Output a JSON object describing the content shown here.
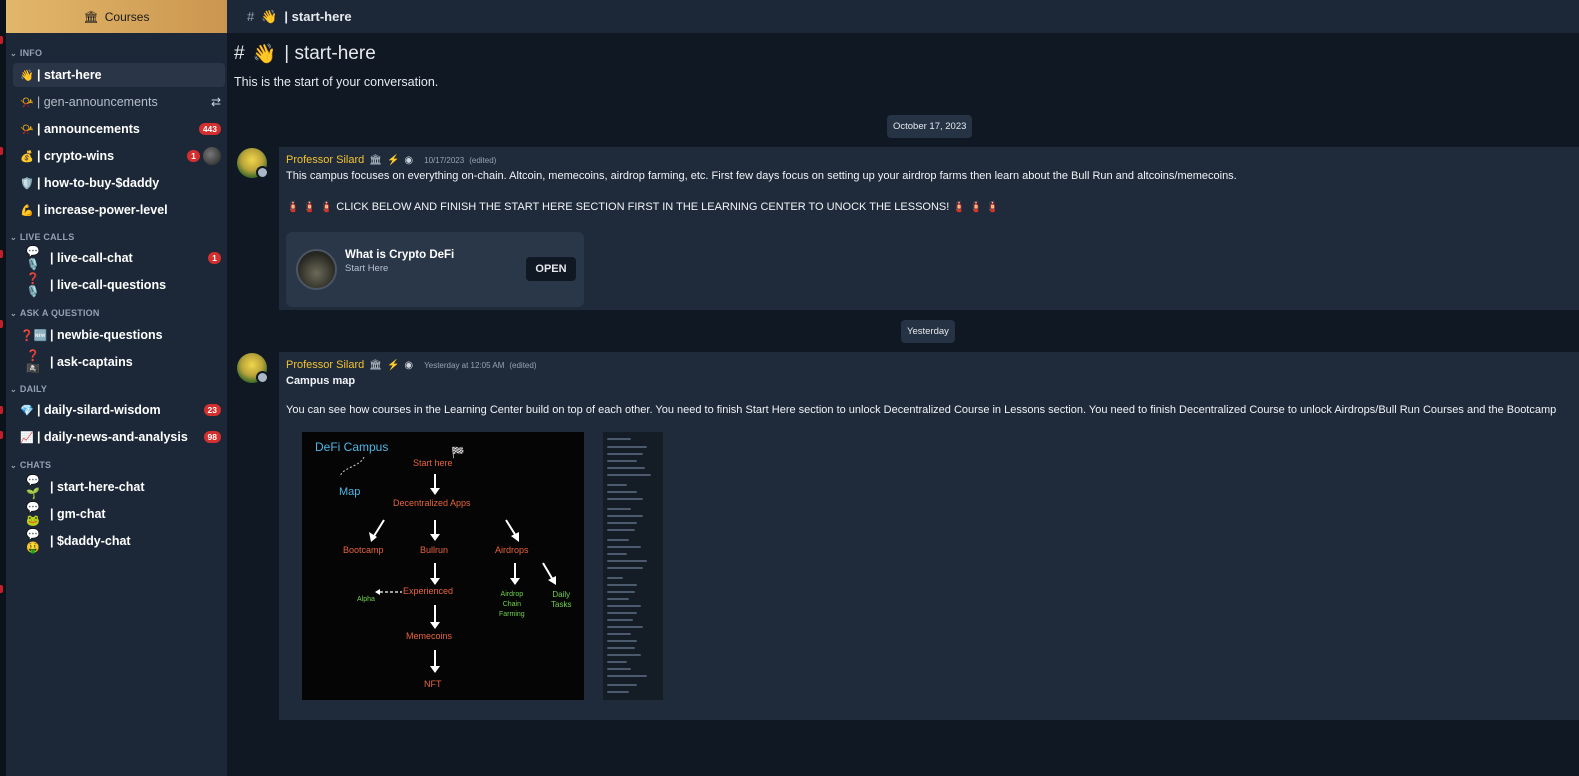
{
  "sidebar": {
    "courses_label": "Courses",
    "categories": {
      "info": "INFO",
      "live_calls": "LIVE CALLS",
      "ask_question": "ASK A QUESTION",
      "daily": "DAILY",
      "chats": "CHATS"
    },
    "channels": [
      {
        "emoji": "👋",
        "label": "| start-here"
      },
      {
        "emoji": "📯",
        "label": "| gen-announcements",
        "icon": "swap-icon"
      },
      {
        "emoji": "📯",
        "label": "| announcements",
        "badge": "443"
      },
      {
        "emoji": "💰",
        "label": "| crypto-wins",
        "badge": "1"
      },
      {
        "emoji": "🛡️",
        "label": "| how-to-buy-$daddy"
      },
      {
        "emoji": "💪",
        "label": "| increase-power-level"
      },
      {
        "emoji": "💬🎙️",
        "label": "| live-call-chat",
        "badge": "1"
      },
      {
        "emoji": "❓🎙️",
        "label": "| live-call-questions"
      },
      {
        "emoji": "❓🆕",
        "label": "| newbie-questions"
      },
      {
        "emoji": "❓🏴‍☠️",
        "label": "| ask-captains"
      },
      {
        "emoji": "💎",
        "label": "| daily-silard-wisdom",
        "badge": "23"
      },
      {
        "emoji": "📈",
        "label": "| daily-news-and-analysis",
        "badge": "98"
      },
      {
        "emoji": "💬🌱",
        "label": "| start-here-chat"
      },
      {
        "emoji": "💬🐸",
        "label": "| gm-chat"
      },
      {
        "emoji": "💬🤑",
        "label": "| $daddy-chat"
      }
    ]
  },
  "topbar": {
    "hash": "#",
    "emoji": "👋",
    "title": "| start-here"
  },
  "header": {
    "hash": "#",
    "emoji": "👋",
    "title": "| start-here",
    "subtitle": "This is the start of your conversation."
  },
  "dates": {
    "first": "October 17, 2023",
    "second": "Yesterday"
  },
  "messages": [
    {
      "author": "Professor Silard",
      "timestamp": "10/17/2023",
      "edited": "(edited)",
      "line1": "This campus focuses on everything on-chain. Altcoin, memecoins, airdrop farming, etc. First few days focus on setting up your airdrop farms then learn about the Bull Run and altcoins/memecoins.",
      "line2_prefix": "🧯 🧯 🧯",
      "line2": "CLICK BELOW AND FINISH THE START HERE SECTION FIRST IN THE LEARNING CENTER TO UNOCK THE LESSONS!",
      "line2_suffix": "🧯 🧯 🧯",
      "card": {
        "title": "What is Crypto DeFi",
        "subtitle": "Start Here",
        "button": "OPEN"
      }
    },
    {
      "author": "Professor Silard",
      "timestamp": "Yesterday at 12:05 AM",
      "edited": "(edited)",
      "title": "Campus map",
      "body": "You can see how courses in the Learning Center build on top of each other. You need to finish Start Here section to unlock Decentralized Course in Lessons section. You need to finish Decentralized Course to unlock Airdrops/Bull Run Courses and the Bootcamp"
    }
  ],
  "campus_map": {
    "title": "DeFi Campus",
    "map_label": "Map",
    "nodes": {
      "start": "Start here",
      "dapps": "Decentralized Apps",
      "bootcamp": "Bootcamp",
      "bullrun": "Bullrun",
      "airdrops": "Airdrops",
      "alpha": "Alpha",
      "experienced": "Experienced",
      "airdrop_farming": [
        "Airdrop",
        "Chain",
        "Farming"
      ],
      "daily_tasks": [
        "Daily",
        "Tasks"
      ],
      "memecoins": "Memecoins",
      "nft": "NFT"
    }
  }
}
